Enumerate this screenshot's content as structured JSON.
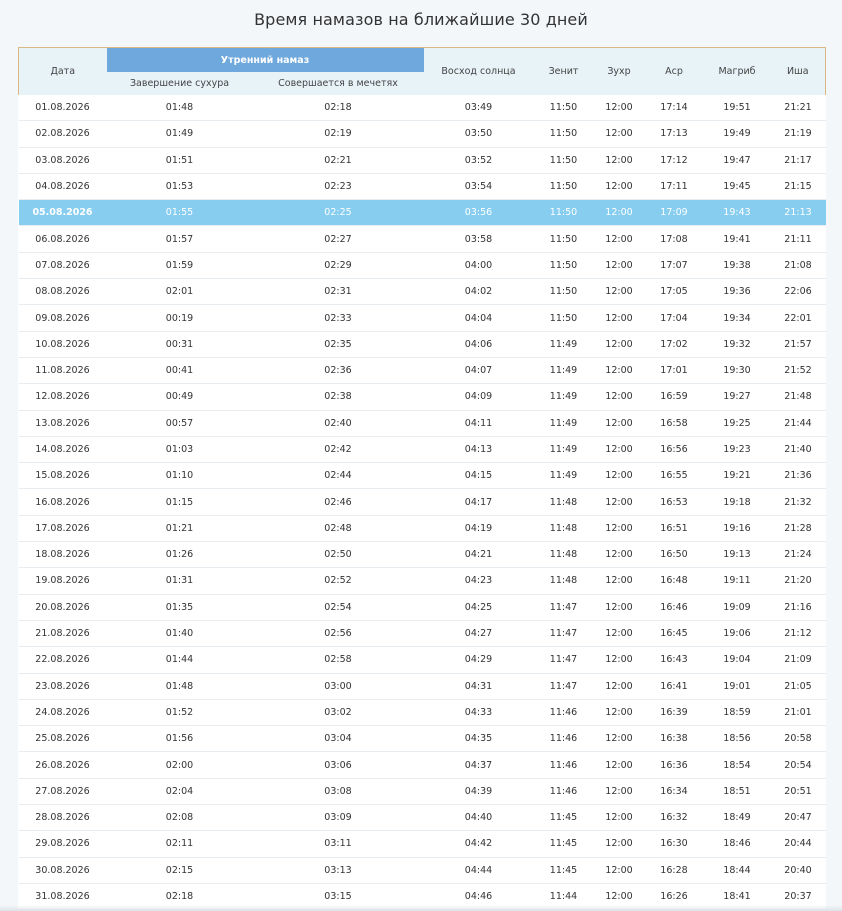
{
  "title": "Время намазов на ближайшие 30 дней",
  "columns": {
    "date": "Дата",
    "morning_group": "Утренний намаз",
    "suhur_end": "Завершение сухура",
    "mosque": "Совершается в мечетях",
    "sunrise": "Восход солнца",
    "zenith": "Зенит",
    "zuhr": "Зухр",
    "asr": "Аср",
    "maghrib": "Магриб",
    "isha": "Иша"
  },
  "highlight_color": "#87cdf0",
  "highlight_row_index": 4,
  "rows": [
    {
      "date": "01.08.2026",
      "suhur_end": "01:48",
      "mosque": "02:18",
      "sunrise": "03:49",
      "zenith": "11:50",
      "zuhr": "12:00",
      "asr": "17:14",
      "maghrib": "19:51",
      "isha": "21:21"
    },
    {
      "date": "02.08.2026",
      "suhur_end": "01:49",
      "mosque": "02:19",
      "sunrise": "03:50",
      "zenith": "11:50",
      "zuhr": "12:00",
      "asr": "17:13",
      "maghrib": "19:49",
      "isha": "21:19"
    },
    {
      "date": "03.08.2026",
      "suhur_end": "01:51",
      "mosque": "02:21",
      "sunrise": "03:52",
      "zenith": "11:50",
      "zuhr": "12:00",
      "asr": "17:12",
      "maghrib": "19:47",
      "isha": "21:17"
    },
    {
      "date": "04.08.2026",
      "suhur_end": "01:53",
      "mosque": "02:23",
      "sunrise": "03:54",
      "zenith": "11:50",
      "zuhr": "12:00",
      "asr": "17:11",
      "maghrib": "19:45",
      "isha": "21:15"
    },
    {
      "date": "05.08.2026",
      "suhur_end": "01:55",
      "mosque": "02:25",
      "sunrise": "03:56",
      "zenith": "11:50",
      "zuhr": "12:00",
      "asr": "17:09",
      "maghrib": "19:43",
      "isha": "21:13"
    },
    {
      "date": "06.08.2026",
      "suhur_end": "01:57",
      "mosque": "02:27",
      "sunrise": "03:58",
      "zenith": "11:50",
      "zuhr": "12:00",
      "asr": "17:08",
      "maghrib": "19:41",
      "isha": "21:11"
    },
    {
      "date": "07.08.2026",
      "suhur_end": "01:59",
      "mosque": "02:29",
      "sunrise": "04:00",
      "zenith": "11:50",
      "zuhr": "12:00",
      "asr": "17:07",
      "maghrib": "19:38",
      "isha": "21:08"
    },
    {
      "date": "08.08.2026",
      "suhur_end": "02:01",
      "mosque": "02:31",
      "sunrise": "04:02",
      "zenith": "11:50",
      "zuhr": "12:00",
      "asr": "17:05",
      "maghrib": "19:36",
      "isha": "22:06"
    },
    {
      "date": "09.08.2026",
      "suhur_end": "00:19",
      "mosque": "02:33",
      "sunrise": "04:04",
      "zenith": "11:50",
      "zuhr": "12:00",
      "asr": "17:04",
      "maghrib": "19:34",
      "isha": "22:01"
    },
    {
      "date": "10.08.2026",
      "suhur_end": "00:31",
      "mosque": "02:35",
      "sunrise": "04:06",
      "zenith": "11:49",
      "zuhr": "12:00",
      "asr": "17:02",
      "maghrib": "19:32",
      "isha": "21:57"
    },
    {
      "date": "11.08.2026",
      "suhur_end": "00:41",
      "mosque": "02:36",
      "sunrise": "04:07",
      "zenith": "11:49",
      "zuhr": "12:00",
      "asr": "17:01",
      "maghrib": "19:30",
      "isha": "21:52"
    },
    {
      "date": "12.08.2026",
      "suhur_end": "00:49",
      "mosque": "02:38",
      "sunrise": "04:09",
      "zenith": "11:49",
      "zuhr": "12:00",
      "asr": "16:59",
      "maghrib": "19:27",
      "isha": "21:48"
    },
    {
      "date": "13.08.2026",
      "suhur_end": "00:57",
      "mosque": "02:40",
      "sunrise": "04:11",
      "zenith": "11:49",
      "zuhr": "12:00",
      "asr": "16:58",
      "maghrib": "19:25",
      "isha": "21:44"
    },
    {
      "date": "14.08.2026",
      "suhur_end": "01:03",
      "mosque": "02:42",
      "sunrise": "04:13",
      "zenith": "11:49",
      "zuhr": "12:00",
      "asr": "16:56",
      "maghrib": "19:23",
      "isha": "21:40"
    },
    {
      "date": "15.08.2026",
      "suhur_end": "01:10",
      "mosque": "02:44",
      "sunrise": "04:15",
      "zenith": "11:49",
      "zuhr": "12:00",
      "asr": "16:55",
      "maghrib": "19:21",
      "isha": "21:36"
    },
    {
      "date": "16.08.2026",
      "suhur_end": "01:15",
      "mosque": "02:46",
      "sunrise": "04:17",
      "zenith": "11:48",
      "zuhr": "12:00",
      "asr": "16:53",
      "maghrib": "19:18",
      "isha": "21:32"
    },
    {
      "date": "17.08.2026",
      "suhur_end": "01:21",
      "mosque": "02:48",
      "sunrise": "04:19",
      "zenith": "11:48",
      "zuhr": "12:00",
      "asr": "16:51",
      "maghrib": "19:16",
      "isha": "21:28"
    },
    {
      "date": "18.08.2026",
      "suhur_end": "01:26",
      "mosque": "02:50",
      "sunrise": "04:21",
      "zenith": "11:48",
      "zuhr": "12:00",
      "asr": "16:50",
      "maghrib": "19:13",
      "isha": "21:24"
    },
    {
      "date": "19.08.2026",
      "suhur_end": "01:31",
      "mosque": "02:52",
      "sunrise": "04:23",
      "zenith": "11:48",
      "zuhr": "12:00",
      "asr": "16:48",
      "maghrib": "19:11",
      "isha": "21:20"
    },
    {
      "date": "20.08.2026",
      "suhur_end": "01:35",
      "mosque": "02:54",
      "sunrise": "04:25",
      "zenith": "11:47",
      "zuhr": "12:00",
      "asr": "16:46",
      "maghrib": "19:09",
      "isha": "21:16"
    },
    {
      "date": "21.08.2026",
      "suhur_end": "01:40",
      "mosque": "02:56",
      "sunrise": "04:27",
      "zenith": "11:47",
      "zuhr": "12:00",
      "asr": "16:45",
      "maghrib": "19:06",
      "isha": "21:12"
    },
    {
      "date": "22.08.2026",
      "suhur_end": "01:44",
      "mosque": "02:58",
      "sunrise": "04:29",
      "zenith": "11:47",
      "zuhr": "12:00",
      "asr": "16:43",
      "maghrib": "19:04",
      "isha": "21:09"
    },
    {
      "date": "23.08.2026",
      "suhur_end": "01:48",
      "mosque": "03:00",
      "sunrise": "04:31",
      "zenith": "11:47",
      "zuhr": "12:00",
      "asr": "16:41",
      "maghrib": "19:01",
      "isha": "21:05"
    },
    {
      "date": "24.08.2026",
      "suhur_end": "01:52",
      "mosque": "03:02",
      "sunrise": "04:33",
      "zenith": "11:46",
      "zuhr": "12:00",
      "asr": "16:39",
      "maghrib": "18:59",
      "isha": "21:01"
    },
    {
      "date": "25.08.2026",
      "suhur_end": "01:56",
      "mosque": "03:04",
      "sunrise": "04:35",
      "zenith": "11:46",
      "zuhr": "12:00",
      "asr": "16:38",
      "maghrib": "18:56",
      "isha": "20:58"
    },
    {
      "date": "26.08.2026",
      "suhur_end": "02:00",
      "mosque": "03:06",
      "sunrise": "04:37",
      "zenith": "11:46",
      "zuhr": "12:00",
      "asr": "16:36",
      "maghrib": "18:54",
      "isha": "20:54"
    },
    {
      "date": "27.08.2026",
      "suhur_end": "02:04",
      "mosque": "03:08",
      "sunrise": "04:39",
      "zenith": "11:46",
      "zuhr": "12:00",
      "asr": "16:34",
      "maghrib": "18:51",
      "isha": "20:51"
    },
    {
      "date": "28.08.2026",
      "suhur_end": "02:08",
      "mosque": "03:09",
      "sunrise": "04:40",
      "zenith": "11:45",
      "zuhr": "12:00",
      "asr": "16:32",
      "maghrib": "18:49",
      "isha": "20:47"
    },
    {
      "date": "29.08.2026",
      "suhur_end": "02:11",
      "mosque": "03:11",
      "sunrise": "04:42",
      "zenith": "11:45",
      "zuhr": "12:00",
      "asr": "16:30",
      "maghrib": "18:46",
      "isha": "20:44"
    },
    {
      "date": "30.08.2026",
      "suhur_end": "02:15",
      "mosque": "03:13",
      "sunrise": "04:44",
      "zenith": "11:45",
      "zuhr": "12:00",
      "asr": "16:28",
      "maghrib": "18:44",
      "isha": "20:40"
    },
    {
      "date": "31.08.2026",
      "suhur_end": "02:18",
      "mosque": "03:15",
      "sunrise": "04:46",
      "zenith": "11:44",
      "zuhr": "12:00",
      "asr": "16:26",
      "maghrib": "18:41",
      "isha": "20:37"
    }
  ]
}
